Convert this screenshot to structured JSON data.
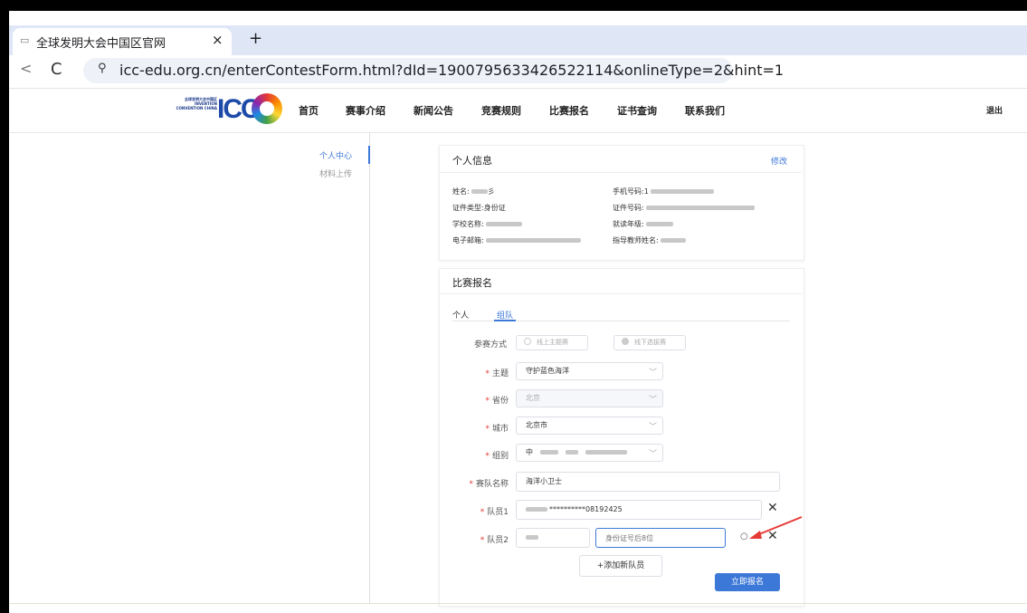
{
  "browser": {
    "tab_title": "全球发明大会中国区官网",
    "tab_close": "×",
    "new_tab": "+",
    "back": "<",
    "reload": "C",
    "url": "icc-edu.org.cn/enterContestForm.html?dId=1900795633426522114&onlineType=2&hint=1"
  },
  "header": {
    "logo_text": "全球发明大会中国区 INVENTION CONVENTION CHINA",
    "logo_mark": "ICC",
    "menu": [
      "首页",
      "赛事介绍",
      "新闻公告",
      "竞赛规则",
      "比赛报名",
      "证书查询",
      "联系我们"
    ],
    "logout": "退出"
  },
  "sidebar": {
    "items": [
      {
        "label": "个人中心",
        "active": true
      },
      {
        "label": "材料上传",
        "active": false
      }
    ]
  },
  "personal_info": {
    "title": "个人信息",
    "edit": "修改",
    "fields": [
      {
        "label": "姓名:",
        "value": "彡"
      },
      {
        "label": "手机号码:",
        "value": "1"
      },
      {
        "label": "证件类型:",
        "value": "身份证"
      },
      {
        "label": "证件号码:",
        "value": ""
      },
      {
        "label": "学校名称:",
        "value": ""
      },
      {
        "label": "就读年级:",
        "value": ""
      },
      {
        "label": "电子邮箱:",
        "value": ""
      },
      {
        "label": "指导教师姓名:",
        "value": ""
      }
    ]
  },
  "registration": {
    "title": "比赛报名",
    "tabs": [
      {
        "label": "个人",
        "active": false
      },
      {
        "label": "组队",
        "active": true
      }
    ],
    "mode_label": "参赛方式",
    "mode_options": [
      {
        "label": "线上主题赛",
        "selected": false
      },
      {
        "label": "线下选拔赛",
        "selected": true
      }
    ],
    "theme": {
      "label": "主题",
      "value": "守护蓝色海洋"
    },
    "province": {
      "label": "省份",
      "value": "北京"
    },
    "city": {
      "label": "城市",
      "value": "北京市"
    },
    "group": {
      "label": "组别",
      "value": "中"
    },
    "team_name": {
      "label": "赛队名称",
      "value": "海洋小卫士"
    },
    "member1": {
      "label": "队员1",
      "value": "**********08192425"
    },
    "member2": {
      "label": "队员2",
      "name_value": "",
      "id_placeholder": "身份证号后8位"
    },
    "remove_icon": "✕",
    "search_icon": "○",
    "add_member": "+添加新队员",
    "submit": "立即报名"
  },
  "colors": {
    "accent": "#3c78d8",
    "required": "#e53935",
    "annotation_arrow": "#e53935"
  }
}
